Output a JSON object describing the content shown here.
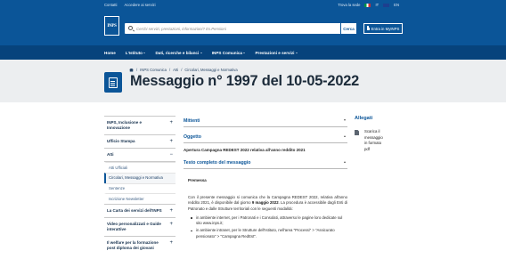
{
  "topbar": {
    "links": [
      "Contatti",
      "Accedere ai servizi"
    ],
    "find_office": "Trova la sede",
    "lang_it": "IT",
    "lang_en": "EN"
  },
  "header": {
    "logo_text": "INPS",
    "search_placeholder": "Cerchi servizi, prestazioni, informazioni? Es.Pensioni",
    "search_button": "Cerca",
    "login_button": "Entra in MyINPS"
  },
  "nav": {
    "items": [
      {
        "label": "Home",
        "dropdown": false
      },
      {
        "label": "L'Istituto",
        "dropdown": true
      },
      {
        "label": "Dati, ricerche e bilanci",
        "dropdown": true
      },
      {
        "label": "INPS Comunica",
        "dropdown": true
      },
      {
        "label": "Prestazioni e servizi",
        "dropdown": true
      }
    ]
  },
  "breadcrumb": [
    "INPS Comunica",
    "Atti",
    "Circolari, Messaggi e Normativa"
  ],
  "page_title": "Messaggio n° 1997 del 10-05-2022",
  "sidebar": {
    "items": [
      {
        "label": "INPS, Inclusione e Innovazione",
        "icon": "+"
      },
      {
        "label": "Ufficio Stampa",
        "icon": "+"
      },
      {
        "label": "Atti",
        "icon": "−"
      },
      {
        "label": "La Carta dei servizi dell'INPS",
        "icon": "+"
      },
      {
        "label": "Video personalizzati e Guide interattive",
        "icon": "+"
      },
      {
        "label": "Il welfare per la formazione post diploma dei giovani",
        "icon": "+"
      }
    ],
    "sub_items": [
      "Atti Ufficiali",
      "Circolari, Messaggi e Normativa",
      "Sentenze",
      "Iscrizione Newsletter"
    ]
  },
  "main": {
    "mittenti_heading": "Mittenti",
    "oggetto_heading": "Oggetto",
    "oggetto_text": "Apertura Campagna REDEST 2022 relativa all'anno reddito 2021",
    "testo_heading": "Testo completo del messaggio",
    "premessa": "Premessa",
    "para_pre": "Con il presente messaggio si comunica che la Campagna REDEST 2022, relativa all'anno reddito 2021, è disponibile dal giorno ",
    "para_date": "9 maggio 2022",
    "para_post": ". La procedura è accessibile dagli Enti di Patronato e dalle Strutture territoriali con le seguenti modalità:",
    "bullets": [
      "in ambiente internet, per i Patronati e i Consolati, attraverso le pagine loro dedicate sul sito www.inps.it;",
      "in ambiente intranet, per le Strutture dell'Istituto, nell'area \"Processi\" > \"Assicurato pensionato\" > \"Campagna RedEst\"."
    ]
  },
  "attachments": {
    "heading": "Allegati",
    "items": [
      {
        "lines": [
          "Scarica il",
          "messaggio",
          "in formato",
          "pdf"
        ],
        "icon": "pdf-icon"
      }
    ]
  },
  "colors": {
    "brand_blue": "#0b5598",
    "nav_dark_blue": "#07437c",
    "band_grey": "#eceef0"
  }
}
